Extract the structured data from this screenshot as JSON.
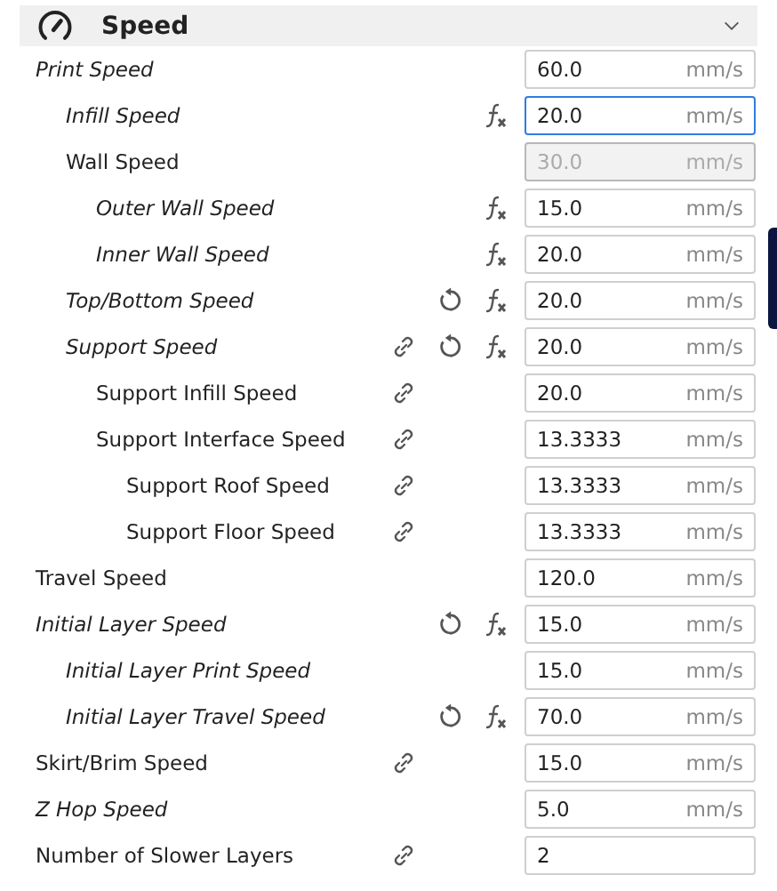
{
  "section": {
    "title": "Speed",
    "expanded": true
  },
  "settings": [
    {
      "label": "Print Speed",
      "modified": true,
      "linked": false,
      "resettable": false,
      "formula": false,
      "value": "60.0",
      "unit": "mm/s",
      "disabled": false,
      "focused": false,
      "children": [
        {
          "label": "Infill Speed",
          "modified": true,
          "linked": false,
          "resettable": false,
          "formula": true,
          "value": "20.0",
          "unit": "mm/s",
          "disabled": false,
          "focused": true
        },
        {
          "label": "Wall Speed",
          "modified": false,
          "linked": false,
          "resettable": false,
          "formula": false,
          "value": "30.0",
          "unit": "mm/s",
          "disabled": true,
          "focused": false,
          "children": [
            {
              "label": "Outer Wall Speed",
              "modified": true,
              "linked": false,
              "resettable": false,
              "formula": true,
              "value": "15.0",
              "unit": "mm/s",
              "disabled": false,
              "focused": false
            },
            {
              "label": "Inner Wall Speed",
              "modified": true,
              "linked": false,
              "resettable": false,
              "formula": true,
              "value": "20.0",
              "unit": "mm/s",
              "disabled": false,
              "focused": false
            }
          ]
        },
        {
          "label": "Top/Bottom Speed",
          "modified": true,
          "linked": false,
          "resettable": true,
          "formula": true,
          "value": "20.0",
          "unit": "mm/s",
          "disabled": false,
          "focused": false
        },
        {
          "label": "Support Speed",
          "modified": true,
          "linked": true,
          "resettable": true,
          "formula": true,
          "value": "20.0",
          "unit": "mm/s",
          "disabled": false,
          "focused": false,
          "children": [
            {
              "label": "Support Infill Speed",
              "modified": false,
              "linked": true,
              "resettable": false,
              "formula": false,
              "value": "20.0",
              "unit": "mm/s",
              "disabled": false,
              "focused": false
            },
            {
              "label": "Support Interface Speed",
              "modified": false,
              "linked": true,
              "resettable": false,
              "formula": false,
              "value": "13.3333",
              "unit": "mm/s",
              "disabled": false,
              "focused": false,
              "children": [
                {
                  "label": "Support Roof Speed",
                  "modified": false,
                  "linked": true,
                  "resettable": false,
                  "formula": false,
                  "value": "13.3333",
                  "unit": "mm/s",
                  "disabled": false,
                  "focused": false
                },
                {
                  "label": "Support Floor Speed",
                  "modified": false,
                  "linked": true,
                  "resettable": false,
                  "formula": false,
                  "value": "13.3333",
                  "unit": "mm/s",
                  "disabled": false,
                  "focused": false
                }
              ]
            }
          ]
        }
      ]
    },
    {
      "label": "Travel Speed",
      "modified": false,
      "linked": false,
      "resettable": false,
      "formula": false,
      "value": "120.0",
      "unit": "mm/s",
      "disabled": false,
      "focused": false
    },
    {
      "label": "Initial Layer Speed",
      "modified": true,
      "linked": false,
      "resettable": true,
      "formula": true,
      "value": "15.0",
      "unit": "mm/s",
      "disabled": false,
      "focused": false,
      "children": [
        {
          "label": "Initial Layer Print Speed",
          "modified": true,
          "linked": false,
          "resettable": false,
          "formula": false,
          "value": "15.0",
          "unit": "mm/s",
          "disabled": false,
          "focused": false
        },
        {
          "label": "Initial Layer Travel Speed",
          "modified": true,
          "linked": false,
          "resettable": true,
          "formula": true,
          "value": "70.0",
          "unit": "mm/s",
          "disabled": false,
          "focused": false
        }
      ]
    },
    {
      "label": "Skirt/Brim Speed",
      "modified": false,
      "linked": true,
      "resettable": false,
      "formula": false,
      "value": "15.0",
      "unit": "mm/s",
      "disabled": false,
      "focused": false
    },
    {
      "label": "Z Hop Speed",
      "modified": true,
      "linked": false,
      "resettable": false,
      "formula": false,
      "value": "5.0",
      "unit": "mm/s",
      "disabled": false,
      "focused": false
    },
    {
      "label": "Number of Slower Layers",
      "modified": false,
      "linked": true,
      "resettable": false,
      "formula": false,
      "value": "2",
      "disabled": false,
      "focused": false
    }
  ]
}
